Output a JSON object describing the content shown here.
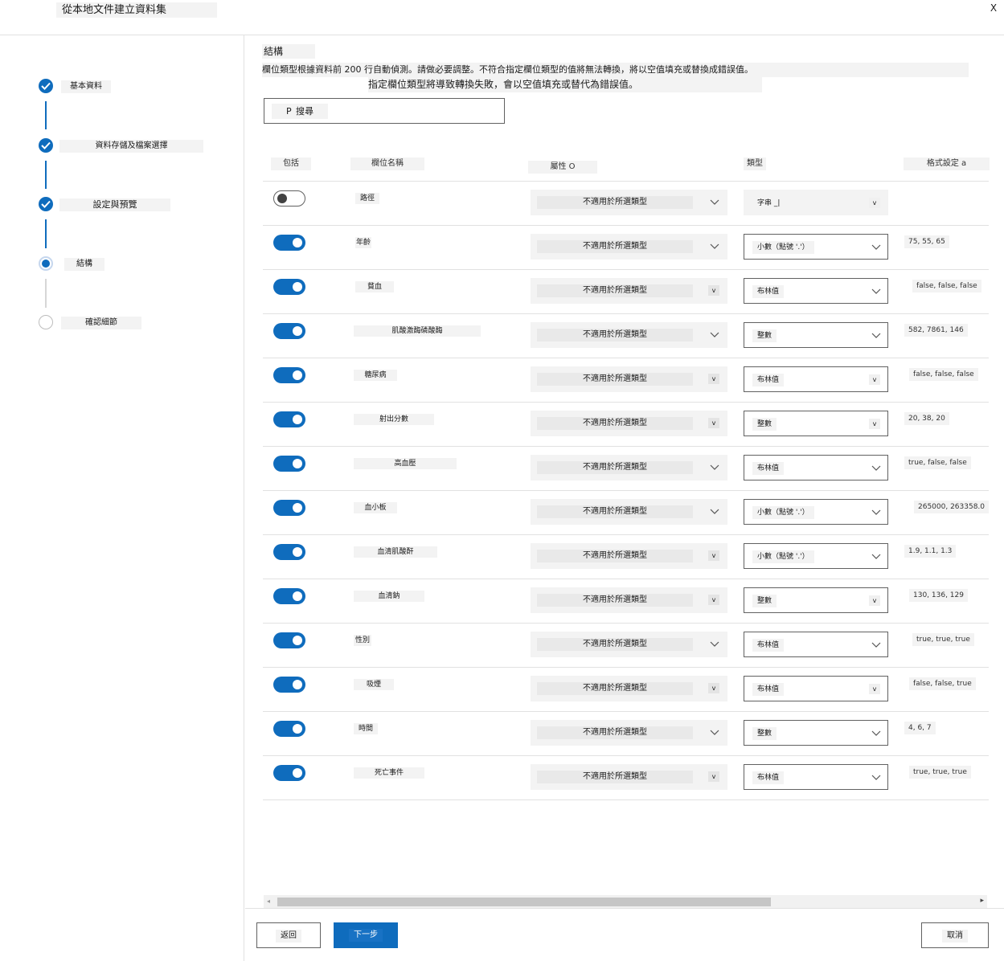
{
  "window": {
    "title": "從本地文件建立資料集",
    "close_label": "X"
  },
  "steps": [
    {
      "label": "基本資料",
      "state": "done"
    },
    {
      "label": "資料存儲及檔案選擇",
      "state": "done"
    },
    {
      "label": "設定與預覽",
      "state": "done"
    },
    {
      "label": "結構",
      "state": "current"
    },
    {
      "label": "確認細節",
      "state": "todo"
    }
  ],
  "main": {
    "section_title": "結構",
    "description": "欄位類型根據資料前 200 行自動偵測。請做必要調整。不符合指定欄位類型的值將無法轉換，將以空值填充或替換成錯誤值。",
    "description_note": "指定欄位類型將導致轉換失敗，會以空值填充或替代為錯誤值。",
    "search_placeholder": "搜尋",
    "search_icon": "P"
  },
  "table": {
    "headers": {
      "include": "包括",
      "column_name": "欄位名稱",
      "property": "屬性 O",
      "type": "類型",
      "format": "格式設定 a"
    },
    "rows": [
      {
        "include": false,
        "name": "路徑",
        "property": "不適用於所選類型",
        "type": "字串 _|",
        "format": ""
      },
      {
        "include": true,
        "name": "年齡",
        "property": "不適用於所選類型",
        "type": "小數（點號 '.'）",
        "format": "75, 55, 65"
      },
      {
        "include": true,
        "name": "貧血",
        "property": "不適用於所選類型",
        "type": "布林值",
        "format": "false, false, false"
      },
      {
        "include": true,
        "name": "肌酸激酶磷酸酶",
        "property": "不適用於所選類型",
        "type": "整數",
        "format": "582, 7861, 146"
      },
      {
        "include": true,
        "name": "糖尿病",
        "property": "不適用於所選類型",
        "type": "布林值",
        "format": "false, false, false"
      },
      {
        "include": true,
        "name": "射出分數",
        "property": "不適用於所選類型",
        "type": "整數",
        "format": "20, 38, 20"
      },
      {
        "include": true,
        "name": "高血壓",
        "property": "不適用於所選類型",
        "type": "布林值",
        "format": "true, false, false"
      },
      {
        "include": true,
        "name": "血小板",
        "property": "不適用於所選類型",
        "type": "小數（點號 '.'）",
        "format": "265000, 263358.0"
      },
      {
        "include": true,
        "name": "血清肌酸酐",
        "property": "不適用於所選類型",
        "type": "小數（點號 '.'）",
        "format": "1.9, 1.1, 1.3"
      },
      {
        "include": true,
        "name": "血清鈉",
        "property": "不適用於所選類型",
        "type": "整數",
        "format": "130, 136, 129"
      },
      {
        "include": true,
        "name": "性別",
        "property": "不適用於所選類型",
        "type": "布林值",
        "format": "true, true, true"
      },
      {
        "include": true,
        "name": "吸煙",
        "property": "不適用於所選類型",
        "type": "布林值",
        "format": "false, false, true"
      },
      {
        "include": true,
        "name": "時間",
        "property": "不適用於所選類型",
        "type": "整數",
        "format": "4, 6, 7"
      },
      {
        "include": true,
        "name": "死亡事件",
        "property": "不適用於所選類型",
        "type": "布林值",
        "format": "true, true, true"
      }
    ]
  },
  "footer": {
    "back_label": "返回",
    "next_label": "下一步",
    "cancel_label": "取消"
  },
  "colors": {
    "accent": "#0f6cbd",
    "border": "#616161",
    "divider": "#e1e1e1"
  },
  "icons": {
    "step_done": "check-circle-icon",
    "step_current": "radio-filled-icon",
    "step_todo": "circle-icon",
    "dropdown": "chevron-down-icon",
    "close": "close-icon"
  }
}
